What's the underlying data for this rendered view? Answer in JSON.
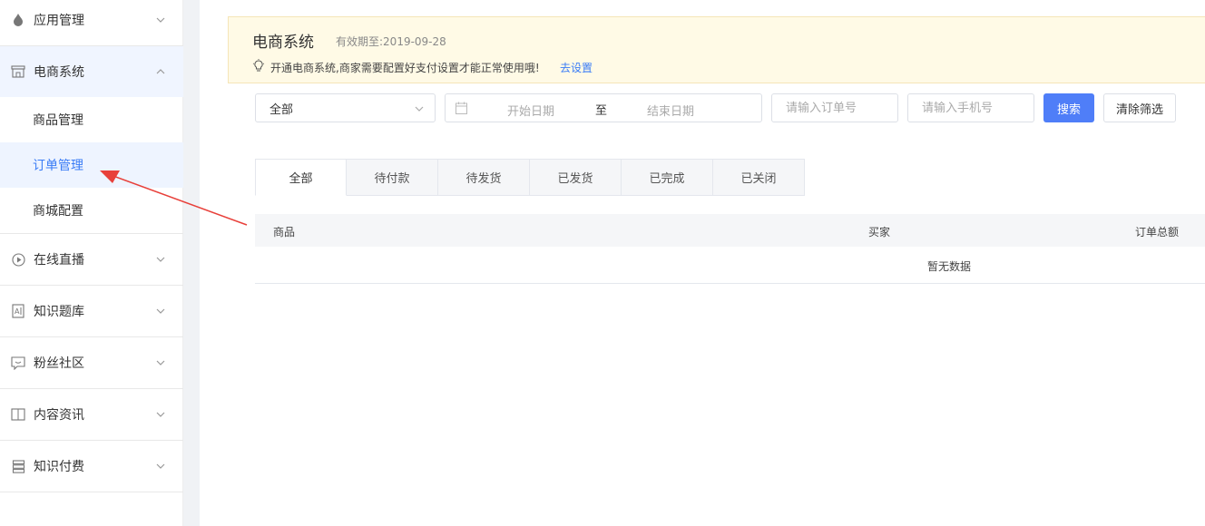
{
  "sidebar": {
    "groups": [
      {
        "label": "应用管理",
        "icon": "drop-icon",
        "open": false
      },
      {
        "label": "电商系统",
        "icon": "store-icon",
        "open": true,
        "items": [
          {
            "label": "商品管理",
            "active": false
          },
          {
            "label": "订单管理",
            "active": true
          },
          {
            "label": "商城配置",
            "active": false
          }
        ]
      },
      {
        "label": "在线直播",
        "icon": "play-icon",
        "open": false
      },
      {
        "label": "知识题库",
        "icon": "quiz-icon",
        "open": false
      },
      {
        "label": "粉丝社区",
        "icon": "chat-icon",
        "open": false
      },
      {
        "label": "内容资讯",
        "icon": "book-icon",
        "open": false
      },
      {
        "label": "知识付费",
        "icon": "stack-icon",
        "open": false
      }
    ]
  },
  "notice": {
    "title": "电商系统",
    "expire": "有效期至:2019-09-28",
    "tip": "开通电商系统,商家需要配置好支付设置才能正常使用哦!",
    "link": "去设置"
  },
  "filters": {
    "status_selected": "全部",
    "start_placeholder": "开始日期",
    "range_sep": "至",
    "end_placeholder": "结束日期",
    "order_placeholder": "请输入订单号",
    "phone_placeholder": "请输入手机号",
    "search_label": "搜索",
    "clear_label": "清除筛选"
  },
  "tabs": [
    "全部",
    "待付款",
    "待发货",
    "已发货",
    "已完成",
    "已关闭"
  ],
  "table": {
    "columns": [
      "商品",
      "买家",
      "订单总额"
    ],
    "empty": "暂无数据"
  },
  "colors": {
    "accent": "#4f7ef8",
    "active_text": "#3a7cf6",
    "notice_bg": "#fffae6",
    "annotation": "#e8403a"
  }
}
